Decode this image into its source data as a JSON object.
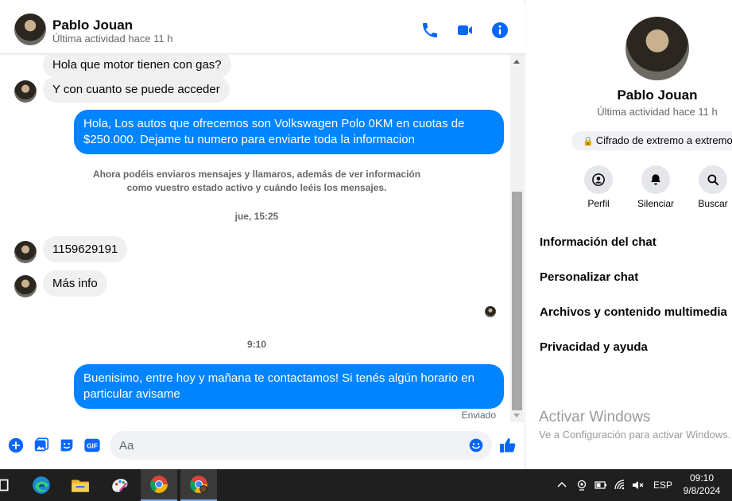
{
  "contact": {
    "name": "Pablo Jouan",
    "status": "Última actividad hace 11 h"
  },
  "header_icons": [
    "phone-icon",
    "video-call-icon",
    "info-icon"
  ],
  "messages": [
    {
      "type": "incoming",
      "text": "Hola que motor tienen con gas?"
    },
    {
      "type": "incoming",
      "text": "Y con cuanto se puede acceder"
    },
    {
      "type": "outgoing",
      "text": "Hola, Los autos que ofrecemos son Volkswagen Polo 0KM en cuotas de $250.000. Dejame tu numero para enviarte toda la informacion"
    },
    {
      "type": "system",
      "text": "Ahora podéis enviaros mensajes y llamaros, además de ver información como vuestro estado activo y cuándo leéis los mensajes."
    },
    {
      "type": "timestamp",
      "text": "jue, 15:25"
    },
    {
      "type": "incoming",
      "text": "1159629191"
    },
    {
      "type": "incoming",
      "text": "Más info"
    },
    {
      "type": "timestamp",
      "text": "9:10"
    },
    {
      "type": "outgoing",
      "text": "Buenisimo, entre hoy y mañana te contactamos! Si tenés algún horario en particular avisame"
    }
  ],
  "sent_label": "Enviado",
  "composer": {
    "placeholder": "Aa",
    "icons": [
      "plus-icon",
      "gallery-icon",
      "sticker-icon",
      "gif-icon",
      "emoji-icon",
      "like-icon"
    ],
    "gif_label": "GIF"
  },
  "info_panel": {
    "name": "Pablo Jouan",
    "status": "Última actividad hace 11 h",
    "encryption": "Cifrado de extremo a extremo",
    "actions": [
      {
        "label": "Perfil",
        "icon": "profile-icon"
      },
      {
        "label": "Silenciar",
        "icon": "bell-icon"
      },
      {
        "label": "Buscar",
        "icon": "search-icon"
      }
    ],
    "menu": [
      "Información del chat",
      "Personalizar chat",
      "Archivos y contenido multimedia",
      "Privacidad y ayuda"
    ],
    "watermark": {
      "title": "Activar Windows",
      "subtitle": "Ve a Configuración para activar Windows."
    }
  },
  "taskbar": {
    "apps": [
      "task-view-icon",
      "edge-icon",
      "file-explorer-icon",
      "paint-icon",
      "chrome-icon",
      "chrome-profile-icon"
    ],
    "language": "ESP",
    "time": "09:10",
    "date": "9/8/2024"
  },
  "colors": {
    "accent": "#0866ff",
    "outgoing_bubble": "#0084ff",
    "incoming_bubble": "#f0f0f0",
    "taskbar": "#1f1f1f"
  }
}
